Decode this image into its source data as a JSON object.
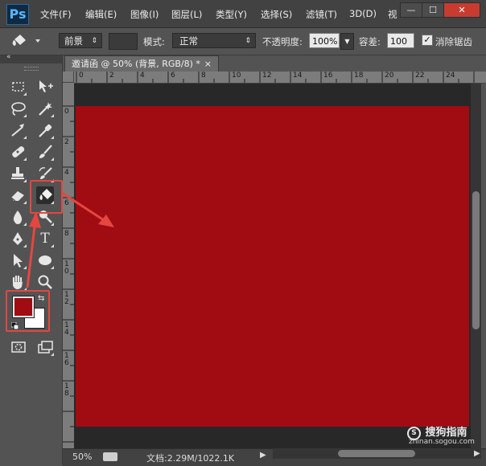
{
  "app": {
    "logo": "Ps"
  },
  "menu": [
    "文件(F)",
    "编辑(E)",
    "图像(I)",
    "图层(L)",
    "类型(Y)",
    "选择(S)",
    "滤镜(T)",
    "3D(D)",
    "视"
  ],
  "window_controls": {
    "minimize": "—",
    "restore": "☐",
    "close": "✕"
  },
  "options_bar": {
    "fill_source": "前景",
    "mode_label": "模式:",
    "mode_value": "正常",
    "opacity_label": "不透明度:",
    "opacity_value": "100%",
    "tolerance_label": "容差:",
    "tolerance_value": "100",
    "antialias_label": "消除锯齿",
    "antialias_checked": true
  },
  "document": {
    "tab_title": "邀请函 @ 50% (背景, RGB/8) *",
    "tab_close": "×",
    "canvas_color": "#a00c12",
    "ruler_h_labels": [
      "0",
      "2",
      "4",
      "6",
      "8",
      "10",
      "12",
      "14",
      "16",
      "18",
      "20",
      "22",
      "24"
    ],
    "ruler_v_labels": [
      "0",
      "2",
      "4",
      "6",
      "8",
      "1 0",
      "1 2",
      "1 4",
      "1 6",
      "1 8"
    ]
  },
  "colors": {
    "foreground": "#a00c12",
    "background": "#ffffff",
    "annotation_red": "#e44740"
  },
  "tools": [
    {
      "name": "rectangular-marquee-icon"
    },
    {
      "name": "move-icon"
    },
    {
      "name": "lasso-icon"
    },
    {
      "name": "magic-wand-icon"
    },
    {
      "name": "crop-icon"
    },
    {
      "name": "eyedropper-icon"
    },
    {
      "name": "healing-brush-icon"
    },
    {
      "name": "brush-icon"
    },
    {
      "name": "clone-stamp-icon"
    },
    {
      "name": "history-brush-icon"
    },
    {
      "name": "eraser-icon"
    },
    {
      "name": "paint-bucket-icon",
      "selected": true
    },
    {
      "name": "blur-icon"
    },
    {
      "name": "dodge-icon"
    },
    {
      "name": "pen-icon"
    },
    {
      "name": "type-icon",
      "text": "T"
    },
    {
      "name": "path-selection-icon"
    },
    {
      "name": "ellipse-icon"
    },
    {
      "name": "hand-icon"
    },
    {
      "name": "zoom-icon"
    }
  ],
  "status": {
    "zoom": "50%",
    "doc_size": "文档:2.29M/1022.1K"
  },
  "watermark": {
    "brand": "搜狗指南",
    "url": "zhinan.sogou.com"
  }
}
